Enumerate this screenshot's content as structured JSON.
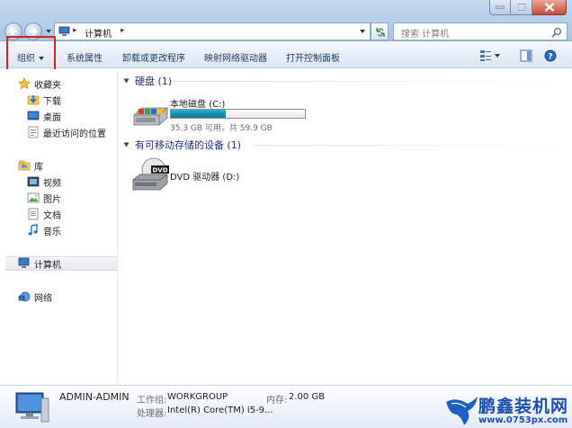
{
  "address": {
    "crumb": "计算机",
    "separator": "▸"
  },
  "search": {
    "placeholder": "搜索 计算机"
  },
  "toolbar": {
    "organize": "组织",
    "system_properties": "系统属性",
    "uninstall": "卸载或更改程序",
    "map_drive": "映射网络驱动器",
    "control_panel": "打开控制面板"
  },
  "nav": {
    "favorites": "收藏夹",
    "downloads": "下载",
    "desktop": "桌面",
    "recent": "最近访问的位置",
    "libraries": "库",
    "videos": "视频",
    "pictures": "图片",
    "documents": "文档",
    "music": "音乐",
    "computer": "计算机",
    "network": "网络"
  },
  "content": {
    "hdd_group": "硬盘 (1)",
    "local_disk": {
      "name": "本地磁盘 (C:)",
      "info": "35.3 GB 可用，共 59.9 GB",
      "used_fraction": 0.41
    },
    "removable_group": "有可移动存储的设备 (1)",
    "dvd": {
      "name": "DVD 驱动器 (D:)",
      "badge": "DVD"
    }
  },
  "details": {
    "computer_name": "ADMIN-ADMIN",
    "workgroup_label": "工作组:",
    "workgroup_value": "WORKGROUP",
    "memory_label": "内存:",
    "memory_value": "2.00 GB",
    "processor_label": "处理器:",
    "processor_value": "Intel(R) Core(TM) i5-9..."
  },
  "watermark": {
    "title": "鹏鑫装机网",
    "url": "www.0753px.com"
  },
  "colors": {
    "accent": "#1e3287",
    "drive_fill": "#1a8fb0",
    "highlight": "#e02020",
    "watermark": "#1d4fb0"
  }
}
